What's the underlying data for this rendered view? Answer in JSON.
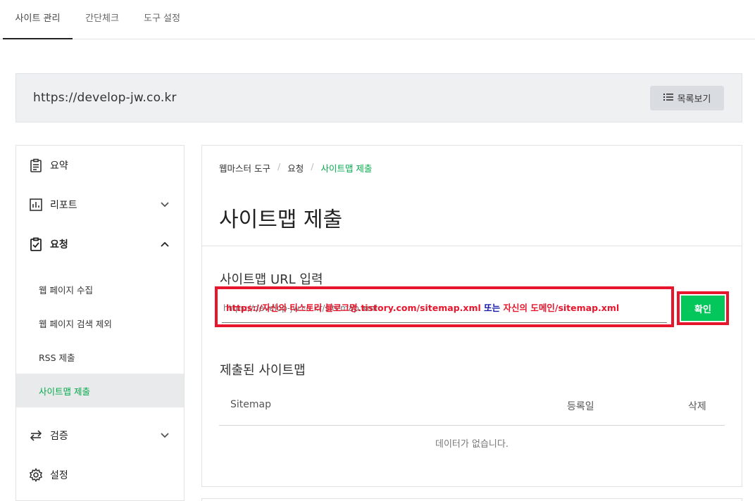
{
  "top_tabs": [
    {
      "label": "사이트 관리",
      "active": true
    },
    {
      "label": "간단체크",
      "active": false
    },
    {
      "label": "도구 설정",
      "active": false
    }
  ],
  "site": {
    "url": "https://develop-jw.co.kr",
    "list_button": "목록보기"
  },
  "sidebar": {
    "items": [
      {
        "label": "요약",
        "icon": "clipboard-icon"
      },
      {
        "label": "리포트",
        "icon": "chart-icon",
        "expanded": false
      },
      {
        "label": "요청",
        "icon": "clipboard-check-icon",
        "expanded": true
      },
      {
        "label": "검증",
        "icon": "sync-icon",
        "expanded": false
      },
      {
        "label": "설정",
        "icon": "gear-icon"
      }
    ],
    "sub_items": [
      {
        "label": "웹 페이지 수집"
      },
      {
        "label": "웹 페이지 검색 제외"
      },
      {
        "label": "RSS 제출"
      },
      {
        "label": "사이트맵 제출",
        "active": true
      }
    ]
  },
  "breadcrumb": [
    "웹마스터 도구",
    "요청",
    "사이트맵 제출"
  ],
  "page_title": "사이트맵 제출",
  "url_section": {
    "label": "사이트맵 URL 입력",
    "placeholder": "https://develop-jw.co.kr/sitemap.xml",
    "annotation_red_1": "https://자신의 티스토리 블로그명.tistory.com/sitemap.xml",
    "annotation_blue": "또는",
    "annotation_red_2": "자신의 도메인/sitemap.xml",
    "confirm_label": "확인"
  },
  "submitted": {
    "label": "제출된 사이트맵",
    "columns": [
      "Sitemap",
      "등록일",
      "삭제"
    ],
    "empty_text": "데이터가 없습니다."
  },
  "colors": {
    "accent_green": "#03c75a",
    "annotation_red": "#e8162d",
    "annotation_blue": "#1a1aa8"
  }
}
